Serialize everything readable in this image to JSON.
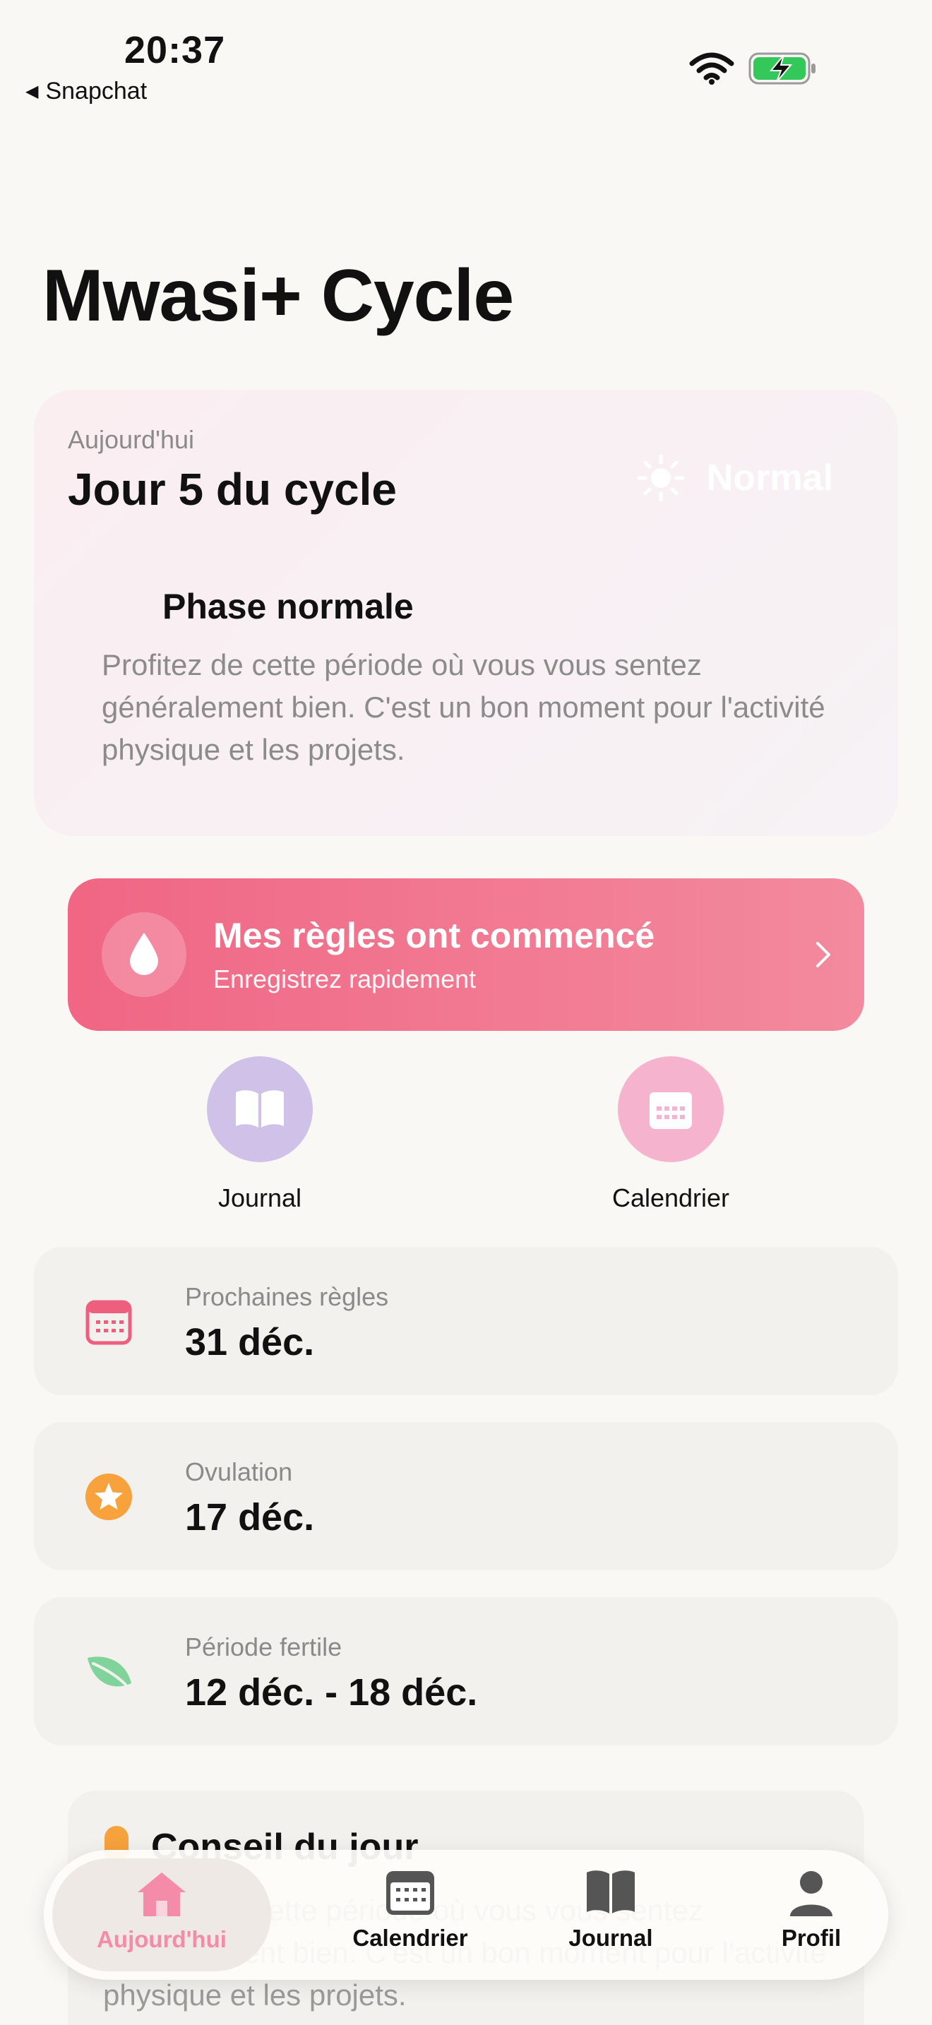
{
  "status_bar": {
    "time": "20:37",
    "back_label": "Snapchat"
  },
  "app": {
    "title": "Mwasi+ Cycle"
  },
  "cycle_card": {
    "today_label": "Aujourd'hui",
    "day_label": "Jour 5 du cycle",
    "status_badge": "Normal",
    "phase_title": "Phase normale",
    "phase_description": "Profitez de cette période où vous vous sentez généralement bien. C'est un bon moment pour l'activité physique et les projets."
  },
  "period_button": {
    "title": "Mes règles ont commencé",
    "subtitle": "Enregistrez rapidement"
  },
  "quick_actions": [
    {
      "label": "Journal",
      "icon": "book-icon"
    },
    {
      "label": "Calendrier",
      "icon": "calendar-icon"
    }
  ],
  "info_cards": [
    {
      "label": "Prochaines règles",
      "value": "31 déc.",
      "icon": "calendar-icon",
      "color": "#ee5f7f"
    },
    {
      "label": "Ovulation",
      "value": "17 déc.",
      "icon": "star-icon",
      "color": "#f7a23c"
    },
    {
      "label": "Période fertile",
      "value": "12 déc. - 18 déc.",
      "icon": "leaf-icon",
      "color": "#7fd39b"
    }
  ],
  "advice_card": {
    "title": "Conseil du jour",
    "body": "Profitez de cette période où vous vous sentez généralement bien. C'est un bon moment pour l'activité physique et les projets."
  },
  "tab_bar": [
    {
      "label": "Aujourd'hui",
      "icon": "home-icon",
      "active": true
    },
    {
      "label": "Calendrier",
      "icon": "calendar-icon",
      "active": false
    },
    {
      "label": "Journal",
      "icon": "book-icon",
      "active": false
    },
    {
      "label": "Profil",
      "icon": "person-icon",
      "active": false
    }
  ],
  "colors": {
    "accent_pink": "#f06684",
    "tab_active": "#f48ba8",
    "background": "#faf8f5"
  }
}
